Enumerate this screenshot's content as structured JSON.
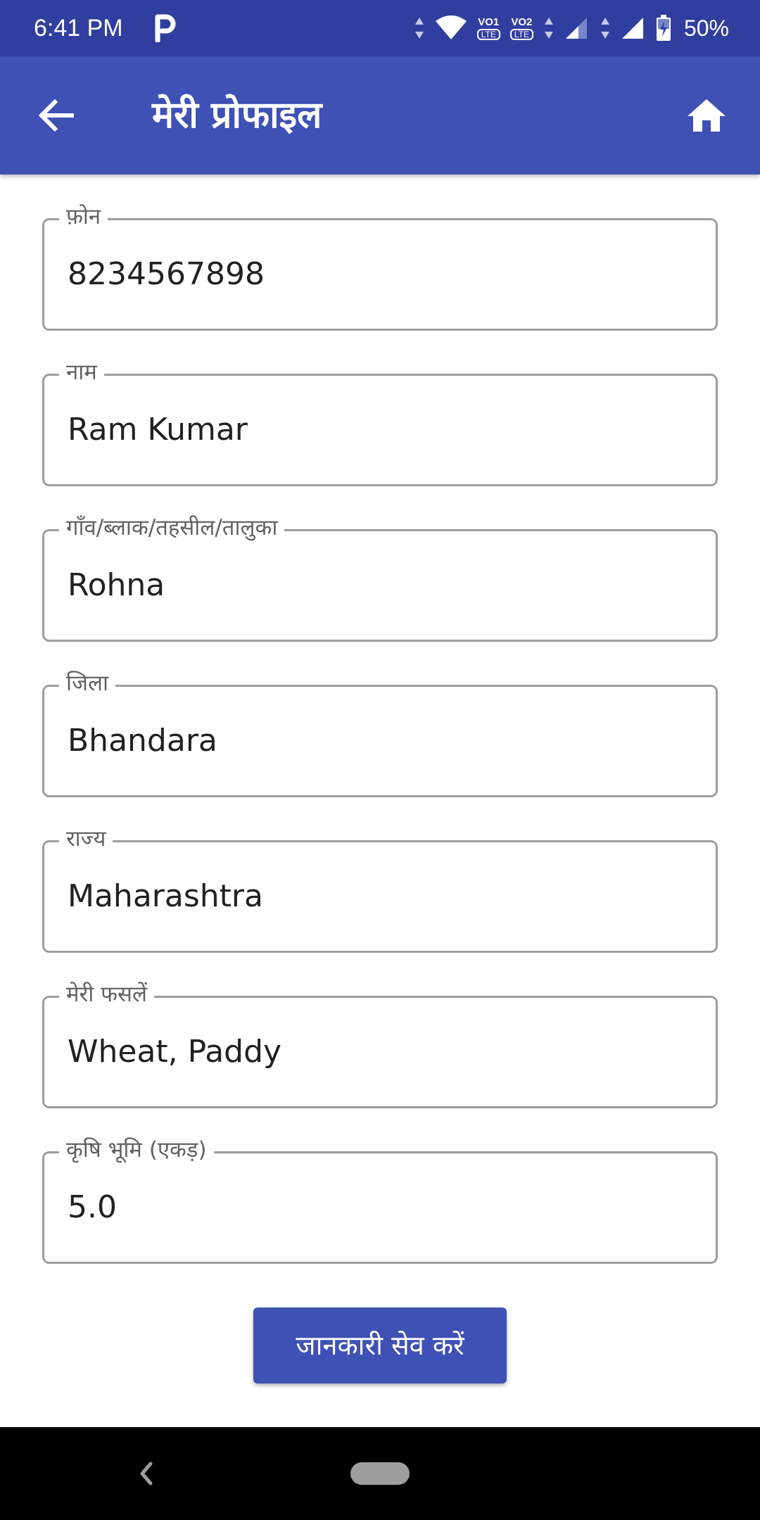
{
  "status_bar": {
    "time": "6:41 PM",
    "battery": "50%",
    "sim1_label": "VO1",
    "sim2_label": "VO2",
    "lte_label": "LTE",
    "icons": [
      "parking-app-icon",
      "data-arrows-icon",
      "wifi-icon",
      "volte-sim1-icon",
      "volte-sim2-icon",
      "signal-sim1-icon",
      "signal-sim2-icon",
      "battery-charging-icon"
    ]
  },
  "app_bar": {
    "title": "मेरी प्रोफाइल",
    "back_icon": "arrow-back-icon",
    "home_icon": "home-icon",
    "background": "#3f51b5"
  },
  "form": {
    "fields": [
      {
        "label": "फ़ोन",
        "value": "8234567898"
      },
      {
        "label": "नाम",
        "value": "Ram Kumar"
      },
      {
        "label": "गाँव/ब्लाक/तहसील/तालुका",
        "value": "Rohna"
      },
      {
        "label": "जिला",
        "value": "Bhandara"
      },
      {
        "label": "राज्य",
        "value": "Maharashtra"
      },
      {
        "label": "मेरी फसलें",
        "value": "Wheat, Paddy"
      },
      {
        "label": "कृषि भूमि (एकड़)",
        "value": "5.0"
      }
    ]
  },
  "actions": {
    "save_label": "जानकारी सेव करें"
  },
  "nav_bar": {
    "back_icon": "nav-back-icon",
    "home_icon": "nav-home-pill-icon"
  }
}
